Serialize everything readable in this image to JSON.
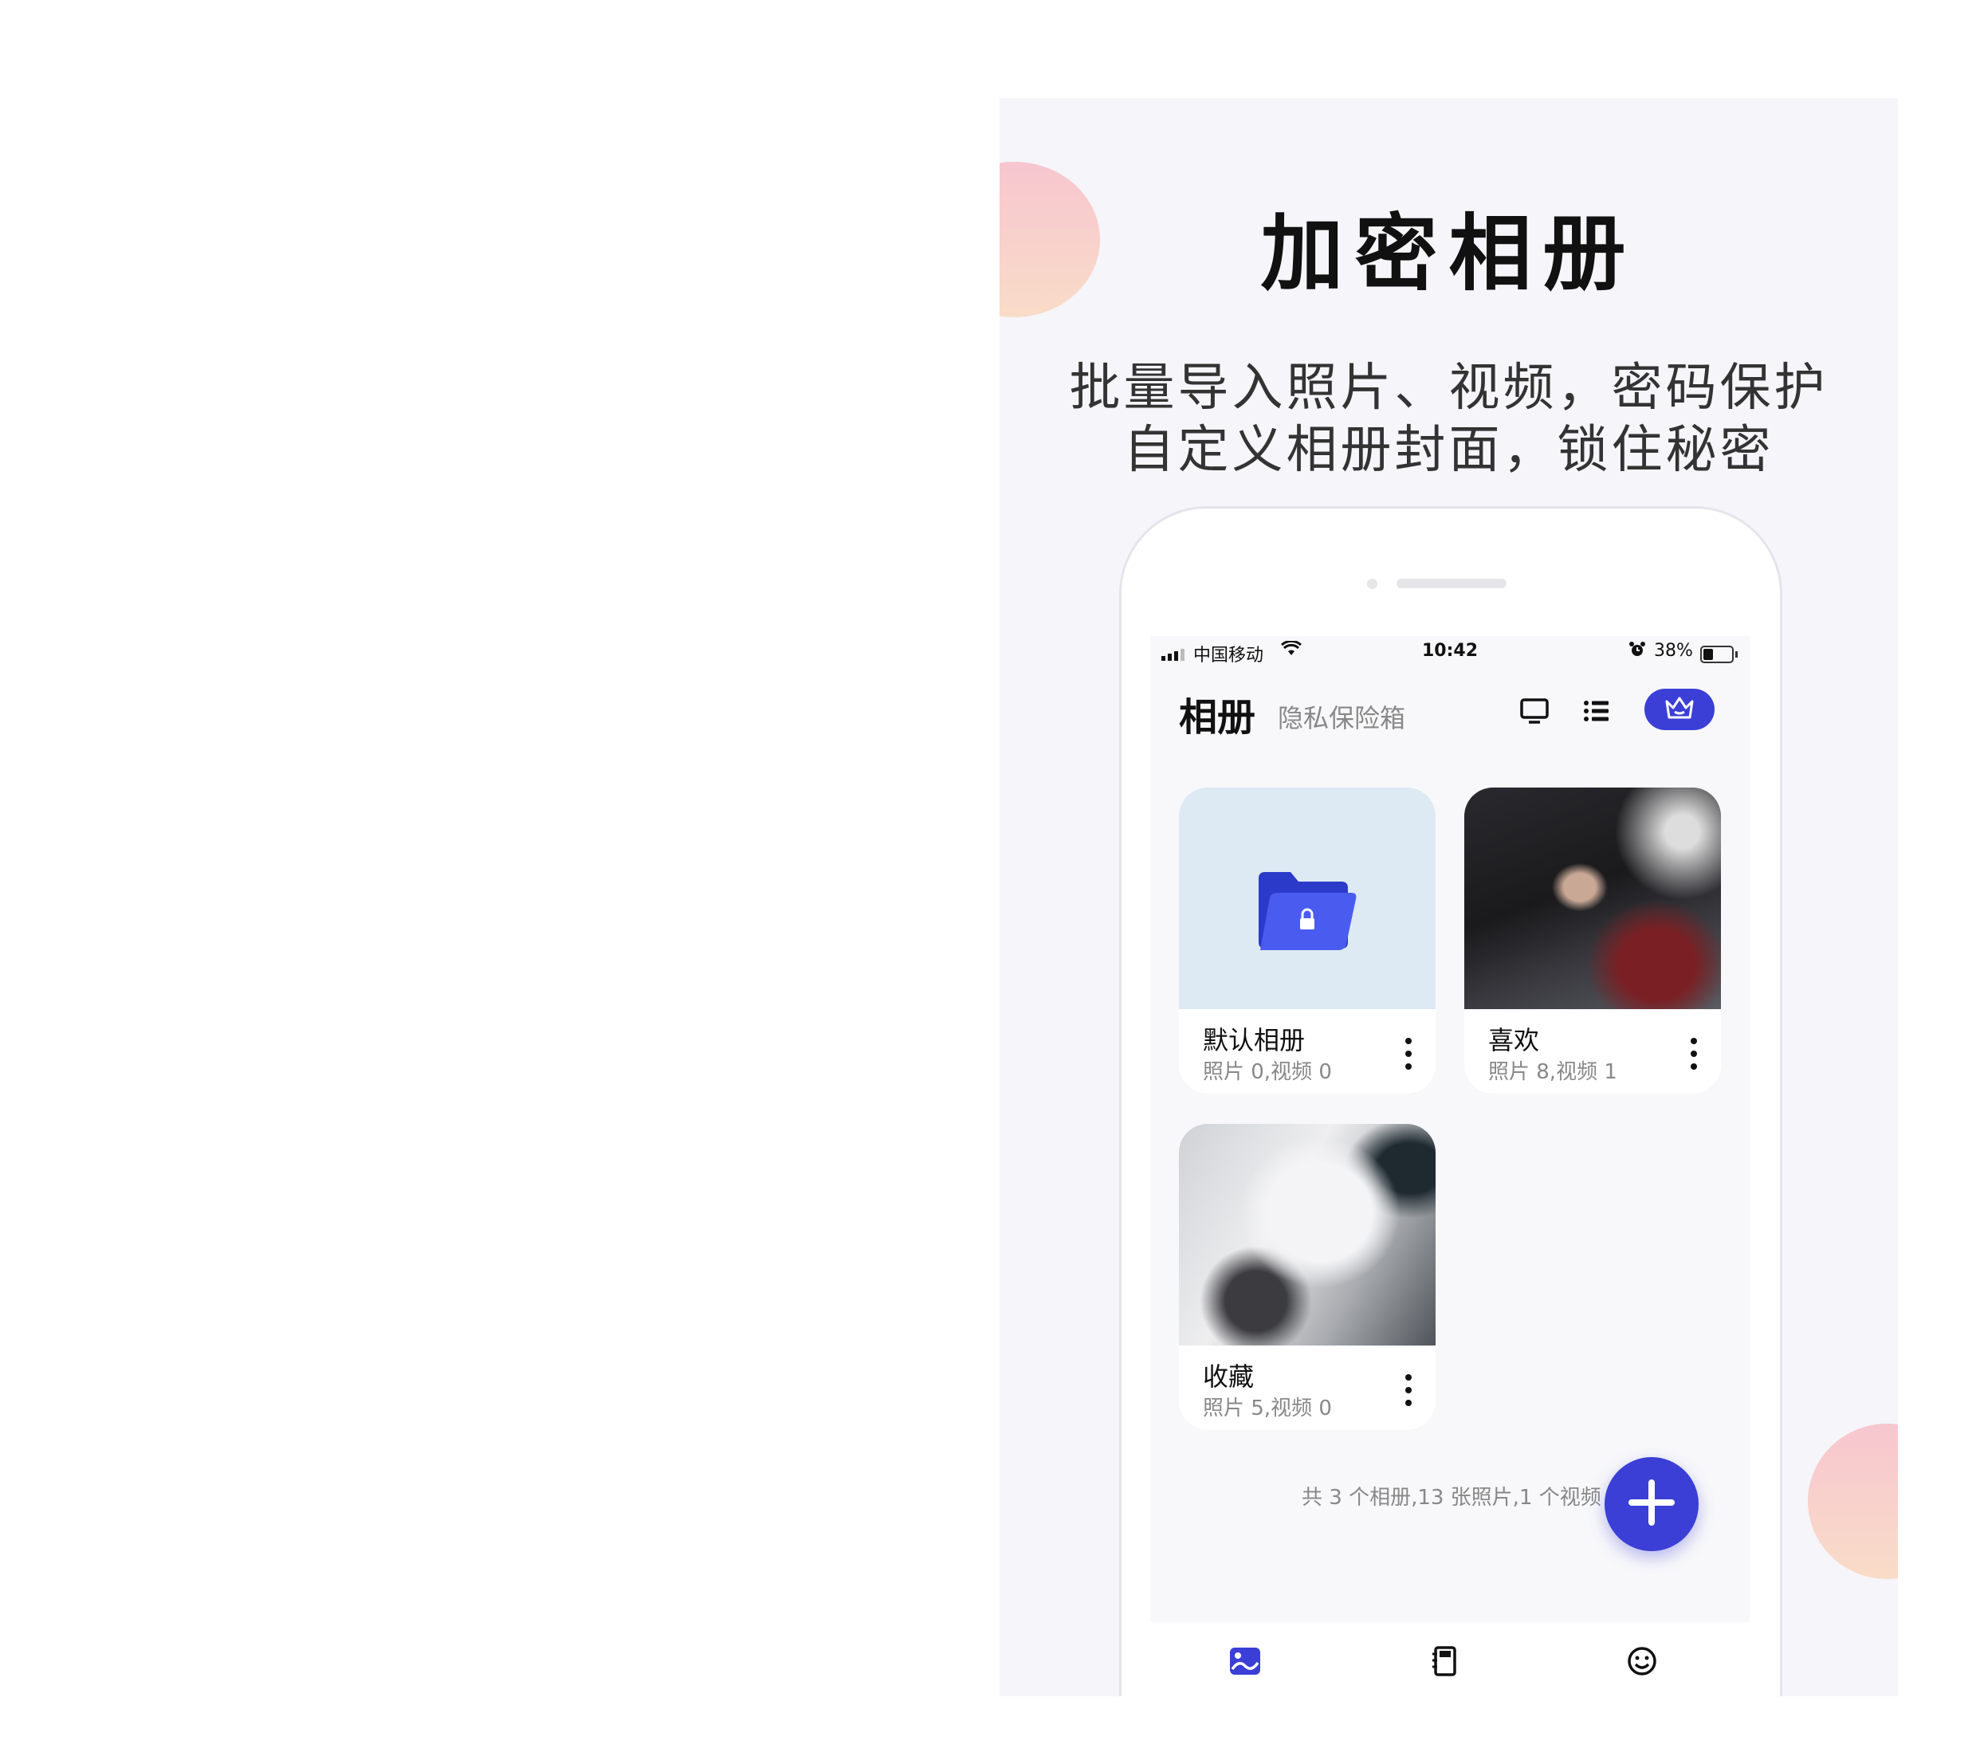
{
  "promo": {
    "headline": "加密相册",
    "subline_1": "批量导入照片、视频，密码保护",
    "subline_2": "自定义相册封面，锁住秘密"
  },
  "status_bar": {
    "carrier": "中国移动",
    "time": "10:42",
    "battery": "38%"
  },
  "header": {
    "title": "相册",
    "subtitle": "隐私保险箱",
    "icons": [
      "tv-icon",
      "list-icon",
      "crown-icon"
    ]
  },
  "albums": [
    {
      "name": "默认相册",
      "meta": "照片 0,视频 0",
      "cover": "folder-lock-icon"
    },
    {
      "name": "喜欢",
      "meta": "照片 8,视频 1",
      "cover": "photo"
    },
    {
      "name": "收藏",
      "meta": "照片 5,视频 0",
      "cover": "photo"
    }
  ],
  "summary": "共 3 个相册,13 张照片,1 个视频",
  "tabbar": [
    "album-icon",
    "notebook-icon",
    "smiley-icon"
  ],
  "colors": {
    "accent": "#3b3fd6",
    "panel_bg": "#f5f5fa",
    "blob": "#f7c6cf"
  }
}
